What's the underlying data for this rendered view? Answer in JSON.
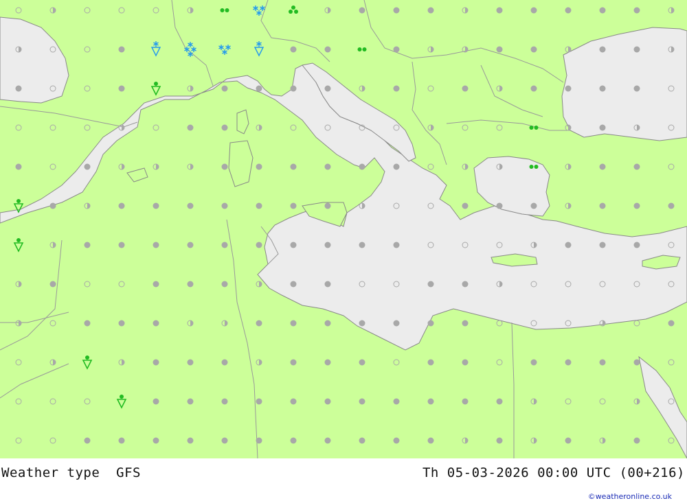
{
  "header": {
    "left_title": "Weather type  GFS",
    "right_title": "Th 05-03-2026 00:00 UTC (00+216)",
    "credit": "©weatheronline.co.uk"
  },
  "colors": {
    "land": "#ccff99",
    "sea": "#ececec",
    "border": "#999999",
    "coast": "#888888",
    "dot_filled": "#a8a8a8",
    "rain_green": "#22bb22",
    "snow_blue": "#2299ee"
  },
  "grid": {
    "columns": 20,
    "rows": 12
  },
  "symbol_legend": {
    "o": "empty-circle-clear",
    "f": "filled-circle-cloudy",
    "h": "half-circle-partly-cloudy",
    "r": "rain-shower",
    "d": "drizzle",
    "t": "three-drop-rain",
    "s": "snow-shower",
    "S": "snow-flakes",
    "x": "heavy-snow"
  },
  "weather_grid": [
    "ohooohdSthfffhfffffh",
    "hoofsxSsffdfhhffhffh",
    "foofrhffffhfofhffffo",
    "ooohoffhoooohoodhfho",
    "fofhhhffffffohhdhffo",
    "rfhfffffffhoofffhfff",
    "rhffffffffffooohfffo",
    "hfoofffhffooffhooooo",
    "hofffhhfffffffooohof",
    "ohrhfffhfffoffoffffo",
    "ooorfffffffffffhooho",
    "oofffffffffffhfhfhfo"
  ]
}
